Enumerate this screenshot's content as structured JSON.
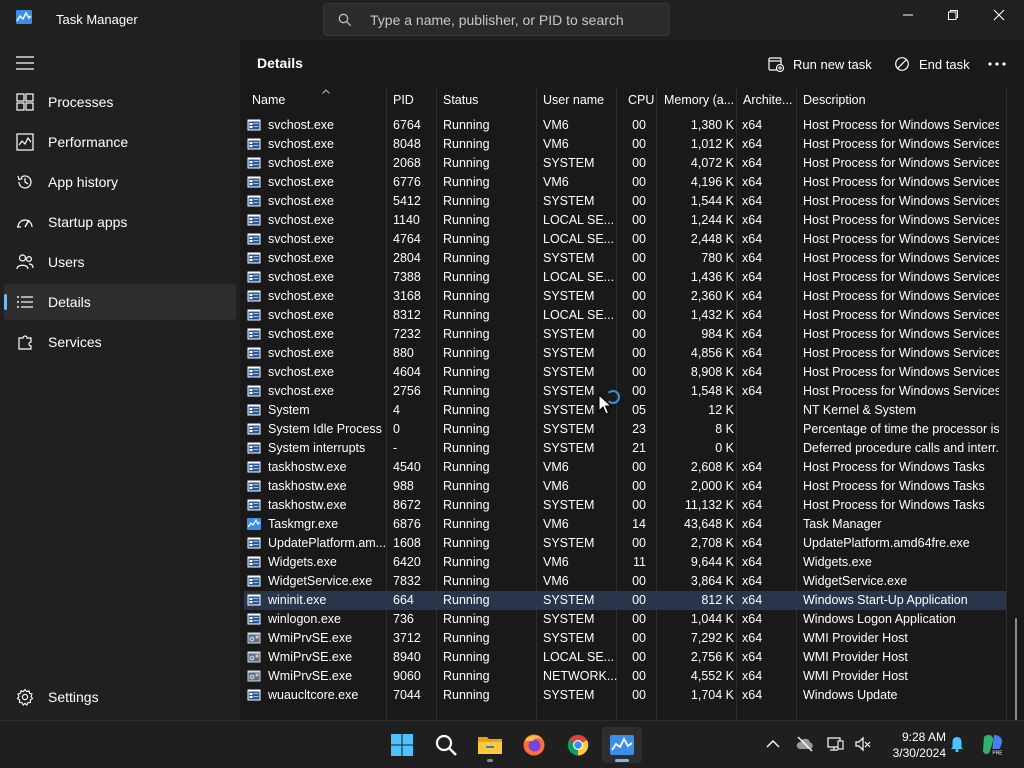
{
  "titlebar": {
    "app_title": "Task Manager",
    "search_placeholder": "Type a name, publisher, or PID to search"
  },
  "sidebar": {
    "items": [
      {
        "label": "Processes",
        "icon": "grid-icon"
      },
      {
        "label": "Performance",
        "icon": "pulse-icon"
      },
      {
        "label": "App history",
        "icon": "history-icon"
      },
      {
        "label": "Startup apps",
        "icon": "speedometer-icon"
      },
      {
        "label": "Users",
        "icon": "users-icon"
      },
      {
        "label": "Details",
        "icon": "list-icon",
        "active": true
      },
      {
        "label": "Services",
        "icon": "puzzle-icon"
      }
    ],
    "settings_label": "Settings"
  },
  "main": {
    "title": "Details",
    "run_task_label": "Run new task",
    "end_task_label": "End task"
  },
  "table": {
    "columns": [
      "Name",
      "PID",
      "Status",
      "User name",
      "CPU",
      "Memory (a...",
      "Archite...",
      "Description"
    ],
    "rows": [
      {
        "icon": "service",
        "name": "svchost.exe",
        "pid": "6764",
        "status": "Running",
        "user": "VM6",
        "cpu": "00",
        "mem": "1,380 K",
        "arch": "x64",
        "desc": "Host Process for Windows Services"
      },
      {
        "icon": "service",
        "name": "svchost.exe",
        "pid": "8048",
        "status": "Running",
        "user": "VM6",
        "cpu": "00",
        "mem": "1,012 K",
        "arch": "x64",
        "desc": "Host Process for Windows Services"
      },
      {
        "icon": "service",
        "name": "svchost.exe",
        "pid": "2068",
        "status": "Running",
        "user": "SYSTEM",
        "cpu": "00",
        "mem": "4,072 K",
        "arch": "x64",
        "desc": "Host Process for Windows Services"
      },
      {
        "icon": "service",
        "name": "svchost.exe",
        "pid": "6776",
        "status": "Running",
        "user": "VM6",
        "cpu": "00",
        "mem": "4,196 K",
        "arch": "x64",
        "desc": "Host Process for Windows Services"
      },
      {
        "icon": "service",
        "name": "svchost.exe",
        "pid": "5412",
        "status": "Running",
        "user": "SYSTEM",
        "cpu": "00",
        "mem": "1,544 K",
        "arch": "x64",
        "desc": "Host Process for Windows Services"
      },
      {
        "icon": "service",
        "name": "svchost.exe",
        "pid": "1140",
        "status": "Running",
        "user": "LOCAL SE...",
        "cpu": "00",
        "mem": "1,244 K",
        "arch": "x64",
        "desc": "Host Process for Windows Services"
      },
      {
        "icon": "service",
        "name": "svchost.exe",
        "pid": "4764",
        "status": "Running",
        "user": "LOCAL SE...",
        "cpu": "00",
        "mem": "2,448 K",
        "arch": "x64",
        "desc": "Host Process for Windows Services"
      },
      {
        "icon": "service",
        "name": "svchost.exe",
        "pid": "2804",
        "status": "Running",
        "user": "SYSTEM",
        "cpu": "00",
        "mem": "780 K",
        "arch": "x64",
        "desc": "Host Process for Windows Services"
      },
      {
        "icon": "service",
        "name": "svchost.exe",
        "pid": "7388",
        "status": "Running",
        "user": "LOCAL SE...",
        "cpu": "00",
        "mem": "1,436 K",
        "arch": "x64",
        "desc": "Host Process for Windows Services"
      },
      {
        "icon": "service",
        "name": "svchost.exe",
        "pid": "3168",
        "status": "Running",
        "user": "SYSTEM",
        "cpu": "00",
        "mem": "2,360 K",
        "arch": "x64",
        "desc": "Host Process for Windows Services"
      },
      {
        "icon": "service",
        "name": "svchost.exe",
        "pid": "8312",
        "status": "Running",
        "user": "LOCAL SE...",
        "cpu": "00",
        "mem": "1,432 K",
        "arch": "x64",
        "desc": "Host Process for Windows Services"
      },
      {
        "icon": "service",
        "name": "svchost.exe",
        "pid": "7232",
        "status": "Running",
        "user": "SYSTEM",
        "cpu": "00",
        "mem": "984 K",
        "arch": "x64",
        "desc": "Host Process for Windows Services"
      },
      {
        "icon": "service",
        "name": "svchost.exe",
        "pid": "880",
        "status": "Running",
        "user": "SYSTEM",
        "cpu": "00",
        "mem": "4,856 K",
        "arch": "x64",
        "desc": "Host Process for Windows Services"
      },
      {
        "icon": "service",
        "name": "svchost.exe",
        "pid": "4604",
        "status": "Running",
        "user": "SYSTEM",
        "cpu": "00",
        "mem": "8,908 K",
        "arch": "x64",
        "desc": "Host Process for Windows Services"
      },
      {
        "icon": "service",
        "name": "svchost.exe",
        "pid": "2756",
        "status": "Running",
        "user": "SYSTEM",
        "cpu": "00",
        "mem": "1,548 K",
        "arch": "x64",
        "desc": "Host Process for Windows Services"
      },
      {
        "icon": "service",
        "name": "System",
        "pid": "4",
        "status": "Running",
        "user": "SYSTEM",
        "cpu": "05",
        "mem": "12 K",
        "arch": "",
        "desc": "NT Kernel & System"
      },
      {
        "icon": "service",
        "name": "System Idle Process",
        "pid": "0",
        "status": "Running",
        "user": "SYSTEM",
        "cpu": "23",
        "mem": "8 K",
        "arch": "",
        "desc": "Percentage of time the processor is..."
      },
      {
        "icon": "service",
        "name": "System interrupts",
        "pid": "-",
        "status": "Running",
        "user": "SYSTEM",
        "cpu": "21",
        "mem": "0 K",
        "arch": "",
        "desc": "Deferred procedure calls and interr..."
      },
      {
        "icon": "service",
        "name": "taskhostw.exe",
        "pid": "4540",
        "status": "Running",
        "user": "VM6",
        "cpu": "00",
        "mem": "2,608 K",
        "arch": "x64",
        "desc": "Host Process for Windows Tasks"
      },
      {
        "icon": "service",
        "name": "taskhostw.exe",
        "pid": "988",
        "status": "Running",
        "user": "VM6",
        "cpu": "00",
        "mem": "2,000 K",
        "arch": "x64",
        "desc": "Host Process for Windows Tasks"
      },
      {
        "icon": "service",
        "name": "taskhostw.exe",
        "pid": "8672",
        "status": "Running",
        "user": "SYSTEM",
        "cpu": "00",
        "mem": "11,132 K",
        "arch": "x64",
        "desc": "Host Process for Windows Tasks"
      },
      {
        "icon": "taskmgr",
        "name": "Taskmgr.exe",
        "pid": "6876",
        "status": "Running",
        "user": "VM6",
        "cpu": "14",
        "mem": "43,648 K",
        "arch": "x64",
        "desc": "Task Manager"
      },
      {
        "icon": "service",
        "name": "UpdatePlatform.am...",
        "pid": "1608",
        "status": "Running",
        "user": "SYSTEM",
        "cpu": "00",
        "mem": "2,708 K",
        "arch": "x64",
        "desc": "UpdatePlatform.amd64fre.exe"
      },
      {
        "icon": "service",
        "name": "Widgets.exe",
        "pid": "6420",
        "status": "Running",
        "user": "VM6",
        "cpu": "11",
        "mem": "9,644 K",
        "arch": "x64",
        "desc": "Widgets.exe"
      },
      {
        "icon": "service",
        "name": "WidgetService.exe",
        "pid": "7832",
        "status": "Running",
        "user": "VM6",
        "cpu": "00",
        "mem": "3,864 K",
        "arch": "x64",
        "desc": "WidgetService.exe"
      },
      {
        "icon": "service",
        "name": "wininit.exe",
        "pid": "664",
        "status": "Running",
        "user": "SYSTEM",
        "cpu": "00",
        "mem": "812 K",
        "arch": "x64",
        "desc": "Windows Start-Up Application",
        "selected": true
      },
      {
        "icon": "service",
        "name": "winlogon.exe",
        "pid": "736",
        "status": "Running",
        "user": "SYSTEM",
        "cpu": "00",
        "mem": "1,044 K",
        "arch": "x64",
        "desc": "Windows Logon Application"
      },
      {
        "icon": "wmi",
        "name": "WmiPrvSE.exe",
        "pid": "3712",
        "status": "Running",
        "user": "SYSTEM",
        "cpu": "00",
        "mem": "7,292 K",
        "arch": "x64",
        "desc": "WMI Provider Host"
      },
      {
        "icon": "wmi",
        "name": "WmiPrvSE.exe",
        "pid": "8940",
        "status": "Running",
        "user": "LOCAL SE...",
        "cpu": "00",
        "mem": "2,756 K",
        "arch": "x64",
        "desc": "WMI Provider Host"
      },
      {
        "icon": "wmi",
        "name": "WmiPrvSE.exe",
        "pid": "9060",
        "status": "Running",
        "user": "NETWORK...",
        "cpu": "00",
        "mem": "4,552 K",
        "arch": "x64",
        "desc": "WMI Provider Host"
      },
      {
        "icon": "service",
        "name": "wuaucltcore.exe",
        "pid": "7044",
        "status": "Running",
        "user": "SYSTEM",
        "cpu": "00",
        "mem": "1,704 K",
        "arch": "x64",
        "desc": "Windows Update"
      }
    ]
  },
  "taskbar": {
    "apps": [
      "start",
      "search",
      "file-explorer",
      "firefox",
      "chrome",
      "task-manager"
    ],
    "time": "9:28 AM",
    "date": "3/30/2024"
  },
  "colors": {
    "accent": "#76b9ed",
    "selected_row": "#28354a",
    "window_bg": "#191919",
    "sidebar_bg": "#202020"
  }
}
